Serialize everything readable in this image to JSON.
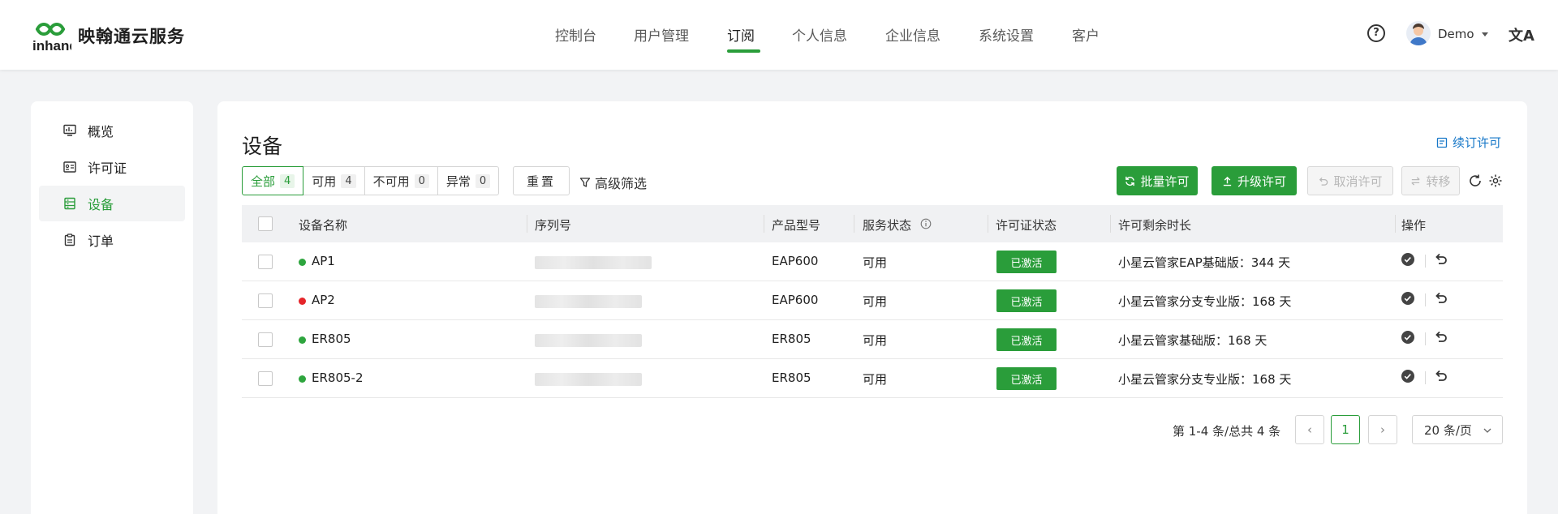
{
  "app": {
    "name": "映翰通云服务",
    "logo_text": "inhand"
  },
  "nav": {
    "items": [
      {
        "label": "控制台"
      },
      {
        "label": "用户管理"
      },
      {
        "label": "订阅",
        "active": true
      },
      {
        "label": "个人信息"
      },
      {
        "label": "企业信息"
      },
      {
        "label": "系统设置"
      },
      {
        "label": "客户"
      }
    ]
  },
  "header": {
    "help_glyph": "?",
    "user_name": "Demo",
    "lang_glyph": "文A"
  },
  "sidebar": {
    "items": [
      {
        "label": "概览",
        "icon": "monitor-icon"
      },
      {
        "label": "许可证",
        "icon": "license-icon"
      },
      {
        "label": "设备",
        "icon": "device-icon",
        "active": true
      },
      {
        "label": "订单",
        "icon": "order-icon"
      }
    ]
  },
  "page": {
    "title": "设备",
    "renew_label": "续订许可"
  },
  "filters": {
    "segments": [
      {
        "label": "全部",
        "count": "4",
        "active": true
      },
      {
        "label": "可用",
        "count": "4"
      },
      {
        "label": "不可用",
        "count": "0"
      },
      {
        "label": "异常",
        "count": "0"
      }
    ],
    "reset_label": "重置",
    "advanced_label": "高级筛选"
  },
  "toolbar": {
    "batch_license": "批量许可",
    "upgrade_license": "升级许可",
    "cancel_license": "取消许可",
    "transfer": "转移"
  },
  "table": {
    "columns": [
      "设备名称",
      "序列号",
      "产品型号",
      "服务状态",
      "许可证状态",
      "许可剩余时长",
      "操作"
    ],
    "rows": [
      {
        "name": "AP1",
        "status_color": "#2ea53e",
        "model": "EAP600",
        "service": "可用",
        "license_status": "已激活",
        "remaining": "小星云管家EAP基础版：344 天"
      },
      {
        "name": "AP2",
        "status_color": "#e5252a",
        "model": "EAP600",
        "service": "可用",
        "license_status": "已激活",
        "remaining": "小星云管家分支专业版：168 天"
      },
      {
        "name": "ER805",
        "status_color": "#2ea53e",
        "model": "ER805",
        "service": "可用",
        "license_status": "已激活",
        "remaining": "小星云管家基础版：168 天"
      },
      {
        "name": "ER805-2",
        "status_color": "#2ea53e",
        "model": "ER805",
        "service": "可用",
        "license_status": "已激活",
        "remaining": "小星云管家分支专业版：168 天"
      }
    ]
  },
  "pagination": {
    "total_text": "第 1-4 条/总共 4 条",
    "current": "1",
    "page_size": "20 条/页",
    "prev_glyph": "‹",
    "next_glyph": "›"
  },
  "colors": {
    "accent": "#2a9d3a",
    "link": "#1677c8"
  }
}
